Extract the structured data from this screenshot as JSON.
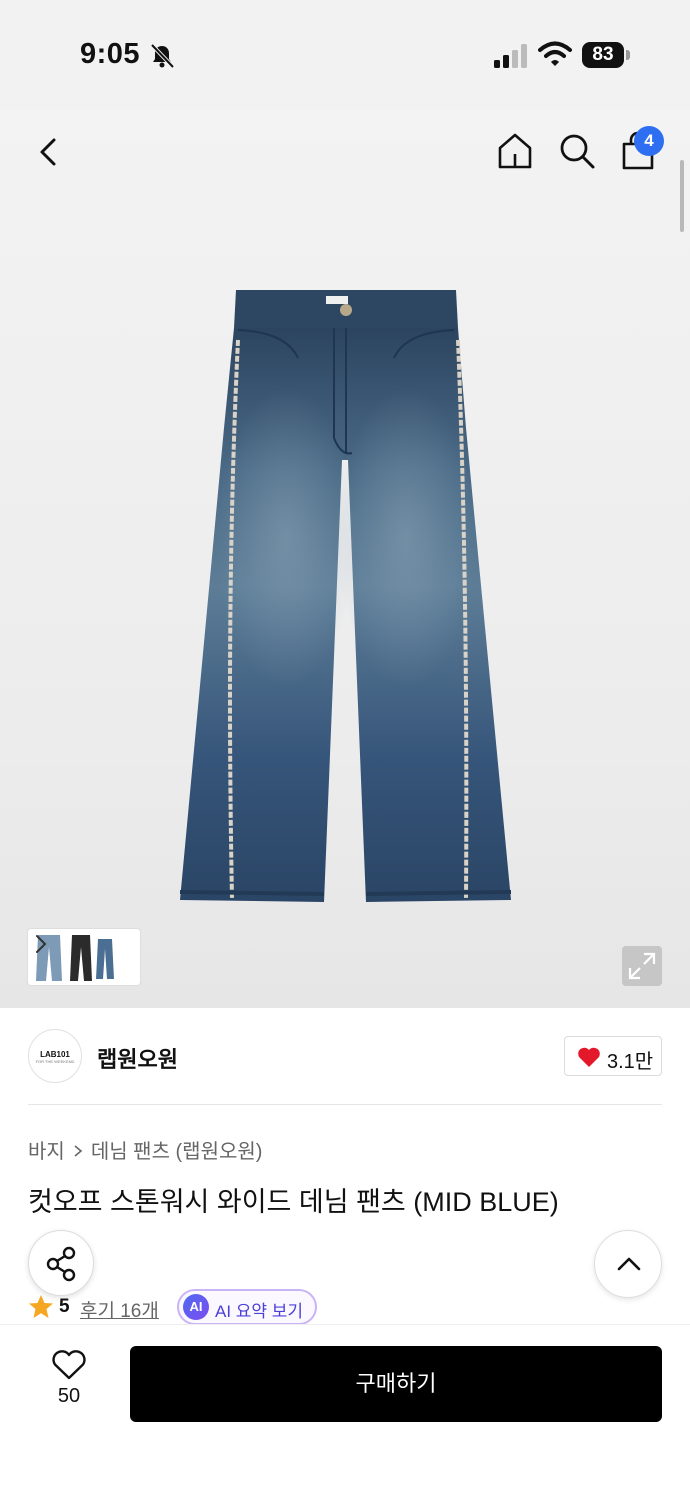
{
  "status_bar": {
    "time": "9:05",
    "battery": "83"
  },
  "header": {
    "cart_count": "4"
  },
  "brand": {
    "logo_text": "LAB101",
    "logo_sub": "FOR THE WEEKEND",
    "name": "랩원오원",
    "likes": "3.1만"
  },
  "breadcrumb": {
    "category": "바지",
    "subcategory": "데님 팬츠 (랩원오원)"
  },
  "product": {
    "title": "컷오프 스톤워시 와이드 데님 팬츠 (MID BLUE)"
  },
  "rating": {
    "score": "5",
    "reviews": "후기 16개",
    "ai_badge": "AI",
    "ai_label": "AI 요약 보기"
  },
  "bottom": {
    "wish_count": "50",
    "buy_label": "구매하기"
  },
  "colors": {
    "accent_blue": "#2e6ff2",
    "heart_red": "#e4182b",
    "star": "#f5a623",
    "ai_purple": "#4b3fd8"
  },
  "icons": [
    "bell-slash-icon",
    "signal-icon",
    "wifi-icon",
    "back-icon",
    "home-icon",
    "search-icon",
    "cart-icon",
    "expand-icon",
    "heart-icon",
    "share-icon",
    "chevron-up-icon",
    "star-icon"
  ]
}
